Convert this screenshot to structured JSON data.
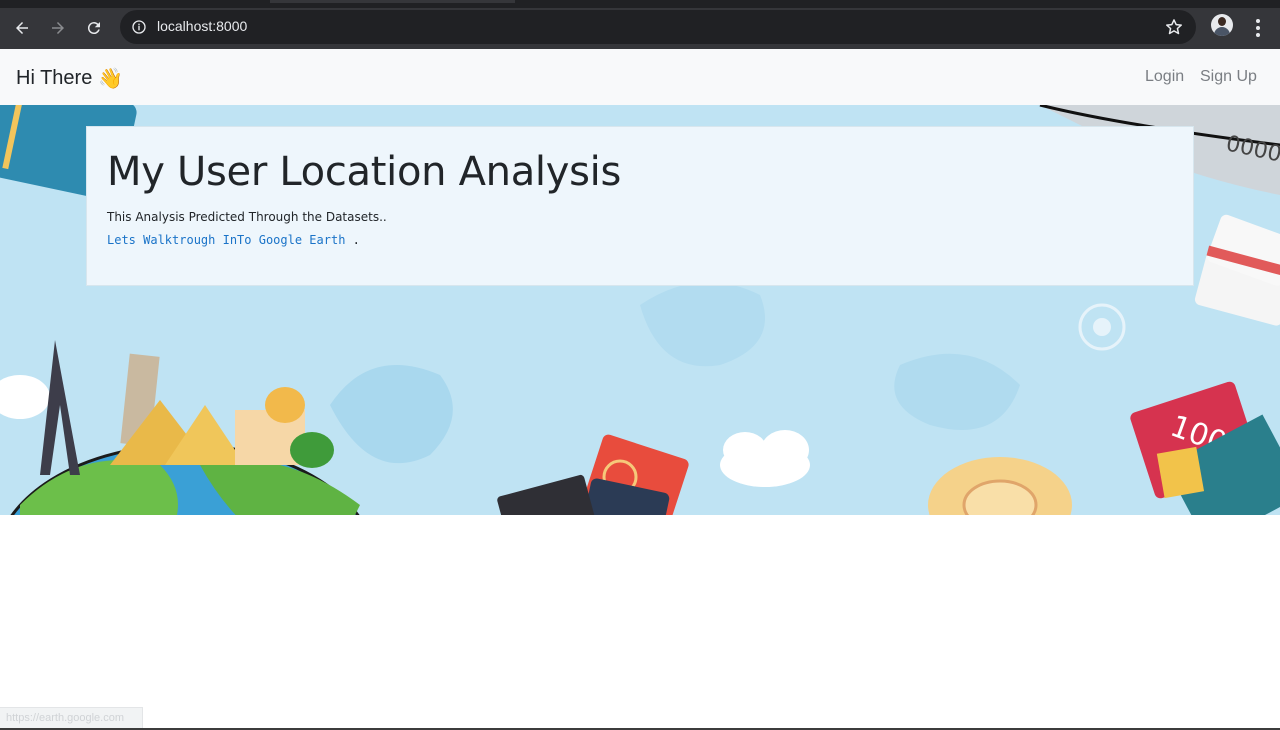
{
  "browser": {
    "url": "localhost:8000",
    "status_url": "https://earth.google.com"
  },
  "navbar": {
    "brand": "Hi There",
    "brand_emoji": "👋",
    "links": [
      {
        "label": "Login"
      },
      {
        "label": "Sign Up"
      }
    ]
  },
  "hero": {
    "title": "My User Location Analysis",
    "lead": "This Analysis Predicted Through the Datasets..",
    "link_text": "Lets Walktrough InTo Google Earth",
    "link_suffix": ".",
    "background_color": "#bfe3f3",
    "link_color": "#1a73c8"
  },
  "icons": [
    "back-arrow-icon",
    "forward-arrow-icon",
    "reload-icon",
    "site-info-icon",
    "bookmark-star-icon",
    "profile-avatar-icon",
    "more-menu-icon",
    "waving-hand-icon"
  ]
}
